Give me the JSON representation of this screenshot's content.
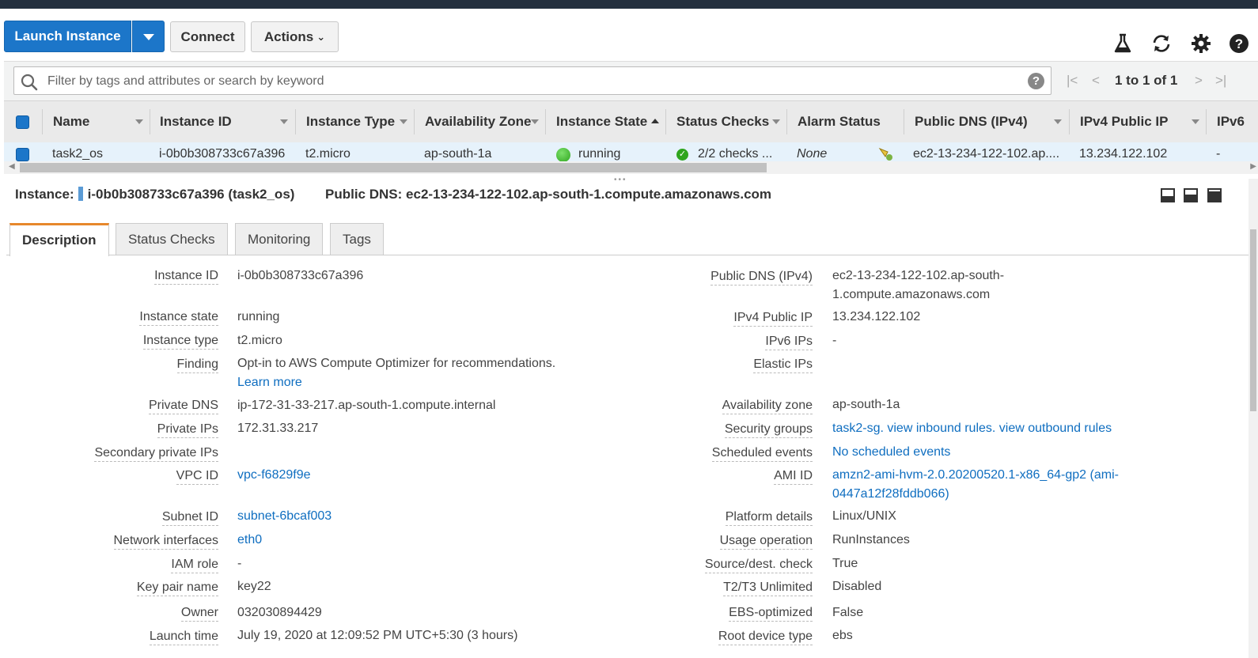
{
  "toolbar": {
    "launch_label": "Launch Instance",
    "connect_label": "Connect",
    "actions_label": "Actions",
    "icons": [
      "flask-icon",
      "refresh-icon",
      "gear-icon",
      "help-icon"
    ]
  },
  "search": {
    "placeholder": "Filter by tags and attributes or search by keyword",
    "help": "?"
  },
  "pagination": {
    "text": "1 to 1 of 1"
  },
  "table": {
    "columns": [
      "Name",
      "Instance ID",
      "Instance Type",
      "Availability Zone",
      "Instance State",
      "Status Checks",
      "Alarm Status",
      "Public DNS (IPv4)",
      "IPv4 Public IP",
      "IPv6"
    ],
    "rows": [
      {
        "name": "task2_os",
        "instance_id": "i-0b0b308733c67a396",
        "instance_type": "t2.micro",
        "az": "ap-south-1a",
        "state": "running",
        "status_checks": "2/2 checks ...",
        "alarm_status": "None",
        "public_dns": "ec2-13-234-122-102.ap....",
        "public_ip": "13.234.122.102",
        "ipv6": "-"
      }
    ]
  },
  "detail": {
    "instance_label": "Instance:",
    "instance_value": "i-0b0b308733c67a396 (task2_os)",
    "dns_label": "Public DNS:",
    "dns_value": "ec2-13-234-122-102.ap-south-1.compute.amazonaws.com"
  },
  "tabs": [
    "Description",
    "Status Checks",
    "Monitoring",
    "Tags"
  ],
  "description": {
    "left": [
      {
        "label": "Instance ID",
        "value": "i-0b0b308733c67a396"
      },
      {
        "label": "Instance state",
        "value": "running"
      },
      {
        "label": "Instance type",
        "value": "t2.micro"
      },
      {
        "label": "Finding",
        "value": "Opt-in to AWS Compute Optimizer for recommendations.",
        "link": "Learn more"
      },
      {
        "label": "Private DNS",
        "value": "ip-172-31-33-217.ap-south-1.compute.internal"
      },
      {
        "label": "Private IPs",
        "value": "172.31.33.217"
      },
      {
        "label": "Secondary private IPs",
        "value": ""
      },
      {
        "label": "VPC ID",
        "value": "vpc-f6829f9e"
      },
      {
        "label": "Subnet ID",
        "value": "subnet-6bcaf003"
      },
      {
        "label": "Network interfaces",
        "value": "eth0"
      },
      {
        "label": "IAM role",
        "value": "-"
      },
      {
        "label": "Key pair name",
        "value": "key22"
      },
      {
        "label": "Owner",
        "value": "032030894429"
      },
      {
        "label": "Launch time",
        "value": "July 19, 2020 at 12:09:52 PM UTC+5:30 (3 hours)"
      }
    ],
    "right": [
      {
        "label": "Public DNS (IPv4)",
        "value": "ec2-13-234-122-102.ap-south-1.compute.amazonaws.com"
      },
      {
        "label": "IPv4 Public IP",
        "value": "13.234.122.102"
      },
      {
        "label": "IPv6 IPs",
        "value": "-"
      },
      {
        "label": "Elastic IPs",
        "value": ""
      },
      {
        "label": "Availability zone",
        "value": "ap-south-1a"
      },
      {
        "label": "Security groups",
        "sg": "task2-sg.",
        "inbound": "view inbound rules.",
        "outbound": "view outbound rules"
      },
      {
        "label": "Scheduled events",
        "value": "No scheduled events"
      },
      {
        "label": "AMI ID",
        "value": "amzn2-ami-hvm-2.0.20200520.1-x86_64-gp2 (ami-0447a12f28fddb066)"
      },
      {
        "label": "Platform details",
        "value": "Linux/UNIX"
      },
      {
        "label": "Usage operation",
        "value": "RunInstances"
      },
      {
        "label": "Source/dest. check",
        "value": "True"
      },
      {
        "label": "T2/T3 Unlimited",
        "value": "Disabled"
      },
      {
        "label": "EBS-optimized",
        "value": "False"
      },
      {
        "label": "Root device type",
        "value": "ebs"
      }
    ]
  },
  "colors": {
    "primary": "#1c76c9",
    "link": "#0f6ec0",
    "tab_accent": "#e7882b",
    "running": "#2fa51e"
  }
}
